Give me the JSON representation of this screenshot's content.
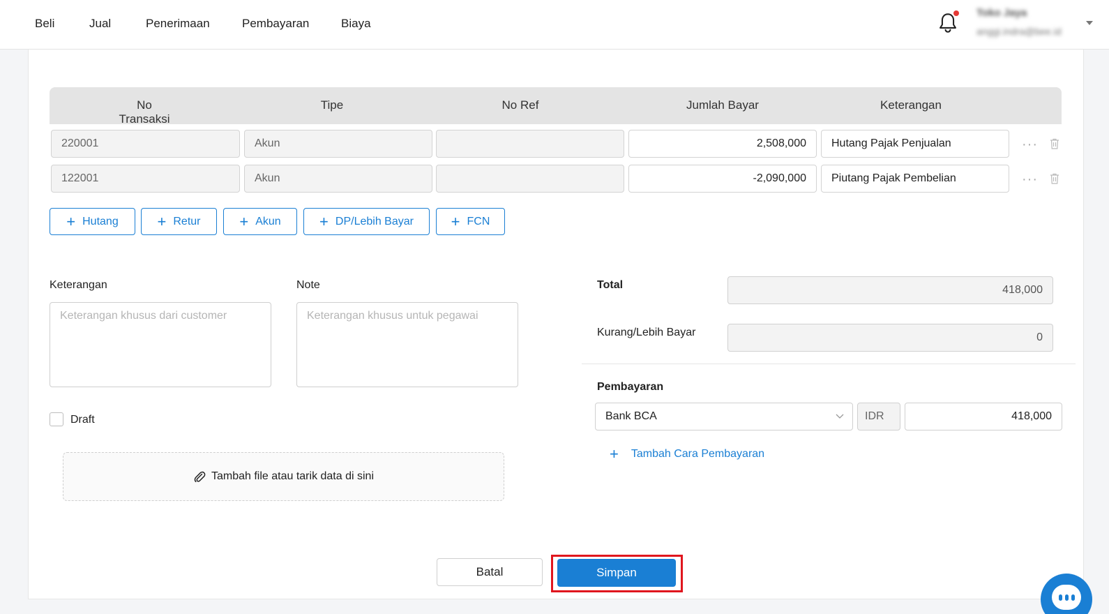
{
  "nav": {
    "items": [
      "Beli",
      "Jual",
      "Penerimaan",
      "Pembayaran",
      "Biaya"
    ]
  },
  "user": {
    "name": "Toko Jaya",
    "email": "anggi.indra@bee.id"
  },
  "table": {
    "headers": [
      "No Transaksi",
      "Tipe",
      "No Ref",
      "Jumlah Bayar",
      "Keterangan"
    ],
    "rows": [
      {
        "no_transaksi": "220001",
        "tipe": "Akun",
        "no_ref": "",
        "jumlah_bayar": "2,508,000",
        "keterangan": "Hutang Pajak Penjualan"
      },
      {
        "no_transaksi": "122001",
        "tipe": "Akun",
        "no_ref": "",
        "jumlah_bayar": "-2,090,000",
        "keterangan": "Piutang Pajak Pembelian"
      }
    ]
  },
  "add_buttons": [
    "Hutang",
    "Retur",
    "Akun",
    "DP/Lebih Bayar",
    "FCN"
  ],
  "form": {
    "keterangan_label": "Keterangan",
    "keterangan_placeholder": "Keterangan khusus dari customer",
    "note_label": "Note",
    "note_placeholder": "Keterangan khusus untuk pegawai",
    "draft_label": "Draft",
    "dropzone_text": "Tambah file atau tarik data di sini"
  },
  "summary": {
    "total_label": "Total",
    "total_value": "418,000",
    "kurang_label": "Kurang/Lebih Bayar",
    "kurang_value": "0",
    "pembayaran_label": "Pembayaran",
    "method": "Bank BCA",
    "currency": "IDR",
    "amount": "418,000",
    "add_payment": "Tambah Cara Pembayaran"
  },
  "actions": {
    "cancel": "Batal",
    "save": "Simpan"
  },
  "colors": {
    "accent": "#1a7fd4",
    "highlight": "#e0161e"
  }
}
